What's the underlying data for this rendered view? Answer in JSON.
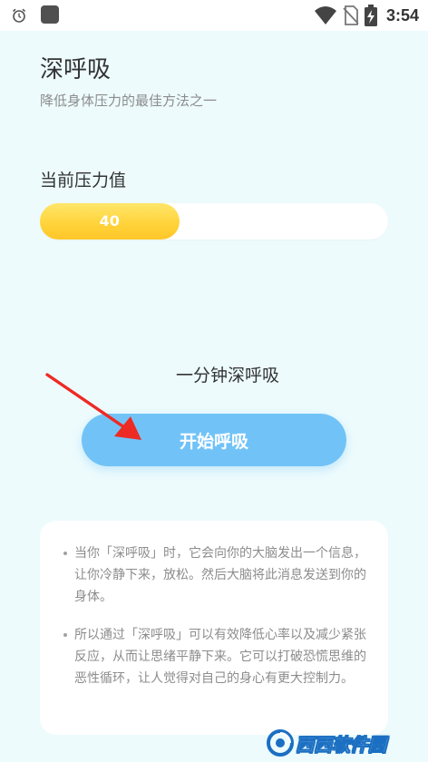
{
  "status_bar": {
    "time": "3:54",
    "icons": [
      "alarm-icon",
      "app-notification-icon",
      "wifi-icon",
      "no-sim-icon",
      "battery-charging-icon"
    ]
  },
  "page": {
    "title": "深呼吸",
    "subtitle": "降低身体压力的最佳方法之一"
  },
  "stress": {
    "label": "当前压力值",
    "value": "40",
    "fraction": 0.4,
    "fill_color": "#ffd43b"
  },
  "session": {
    "label": "一分钟深呼吸",
    "start_button": "开始呼吸",
    "button_color": "#71c3f7"
  },
  "info": {
    "items": [
      "当你「深呼吸」时，它会向你的大脑发出一个信息，让你冷静下来，放松。然后大脑将此消息发送到你的身体。",
      "所以通过「深呼吸」可以有效降低心率以及减少紧张反应，从而让思绪平静下来。它可以打破恐慌思维的恶性循环，让人觉得对自己的身心有更大控制力。"
    ]
  },
  "annotation": {
    "arrow_color": "#ee2a24"
  },
  "watermark": {
    "text": "西西软件园"
  }
}
